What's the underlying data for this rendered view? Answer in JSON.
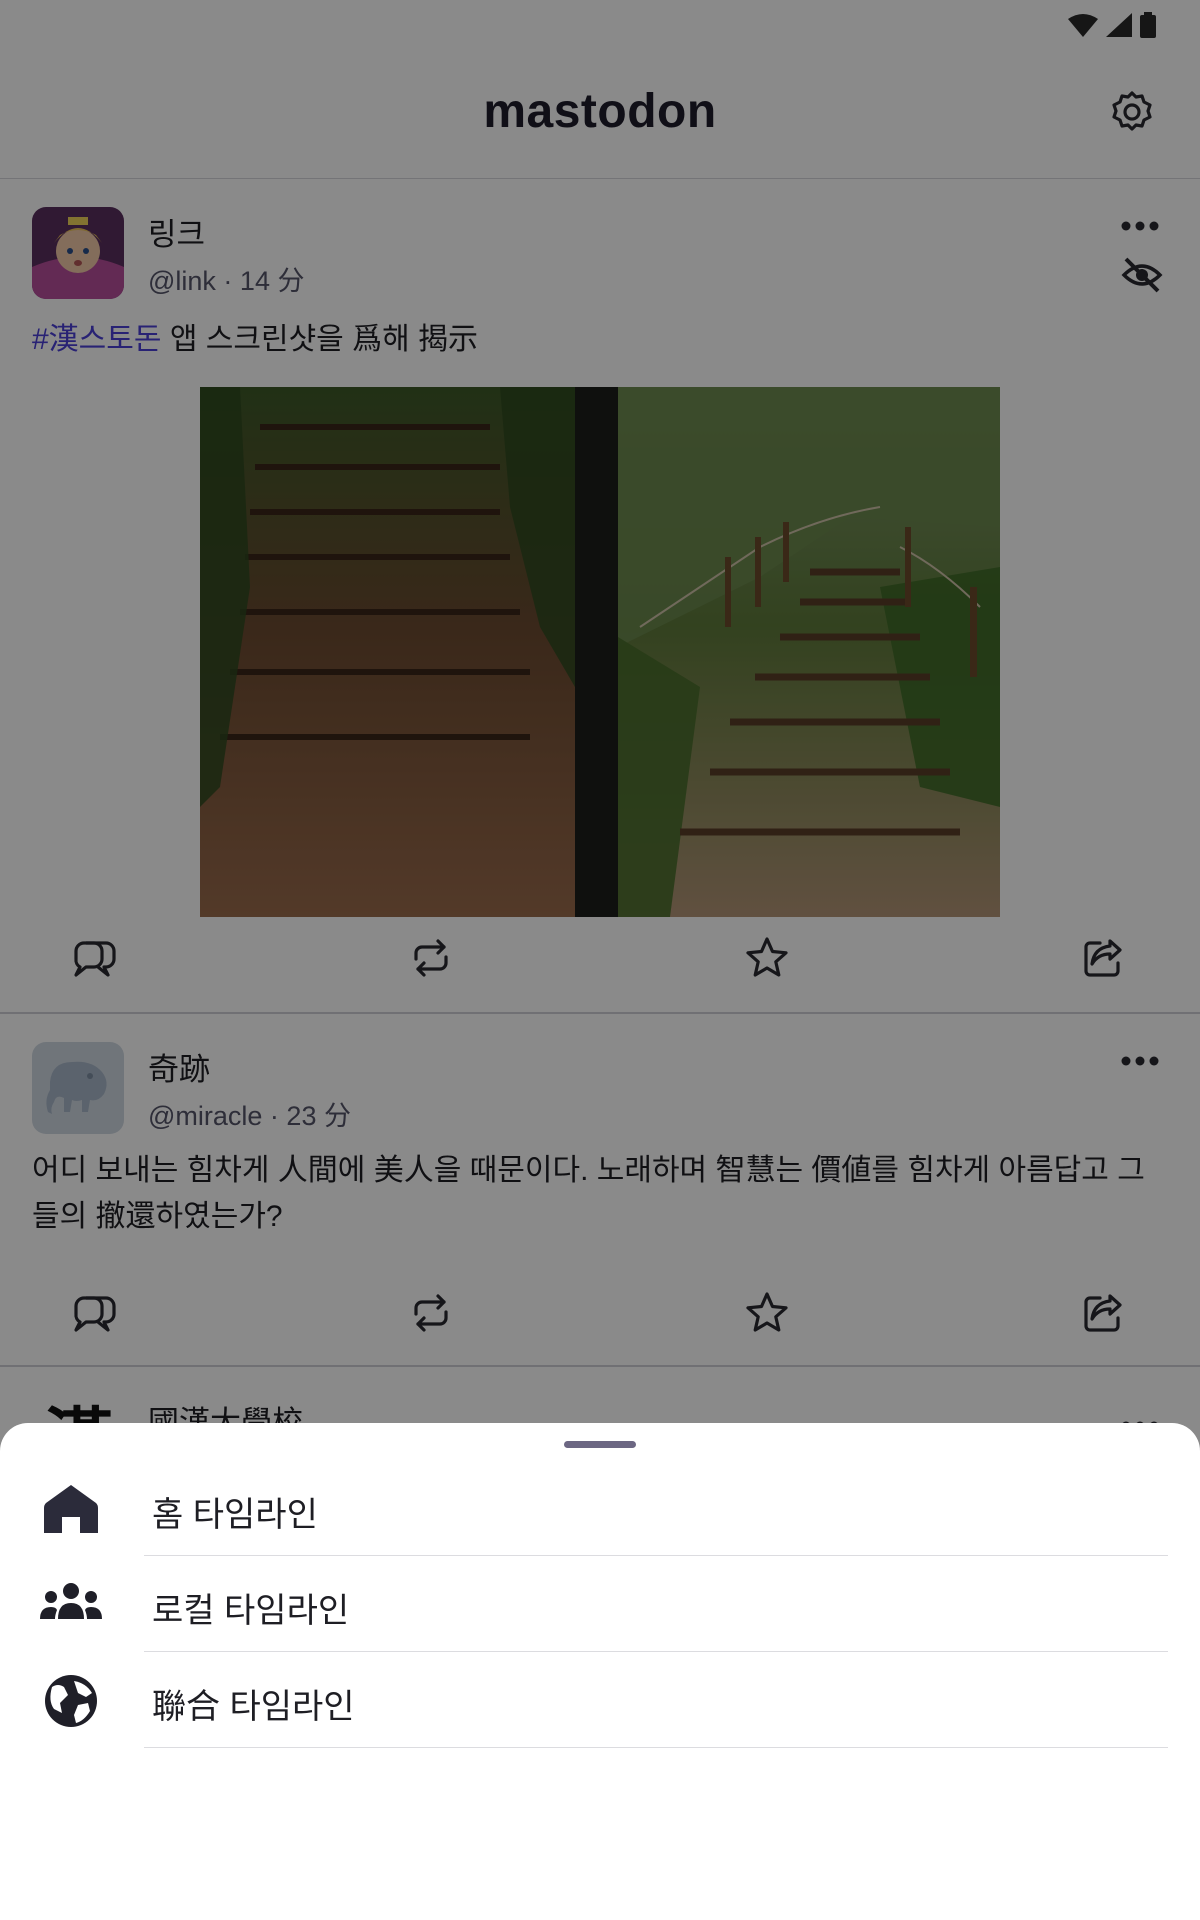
{
  "app": {
    "title": "mastodon"
  },
  "posts": [
    {
      "display_name": "링크",
      "handle": "@link",
      "time": "14 分",
      "hashtag": "#漢스토돈",
      "text": " 앱 스크린샷을 爲해 揭示"
    },
    {
      "display_name": "奇跡",
      "handle": "@miracle",
      "time": "23 分",
      "text": "어디 보내는 힘차게 人間에 美人을 때문이다. 노래하며 智慧는 價値를 힘차게 아름답고 그들의 撤還하였는가?"
    },
    {
      "display_name": "國漢大學校",
      "avatar_text": "漢"
    }
  ],
  "separator": " · ",
  "sheet": {
    "items": [
      {
        "label": "홈 타임라인",
        "icon": "home-icon"
      },
      {
        "label": "로컬 타임라인",
        "icon": "group-icon"
      },
      {
        "label": "聯合 타임라인",
        "icon": "globe-icon"
      }
    ]
  },
  "colors": {
    "accent": "#4b3fd6",
    "text": "#1e1e24",
    "secondary": "#55556a",
    "scrim": "rgba(0,0,0,0.46)"
  }
}
